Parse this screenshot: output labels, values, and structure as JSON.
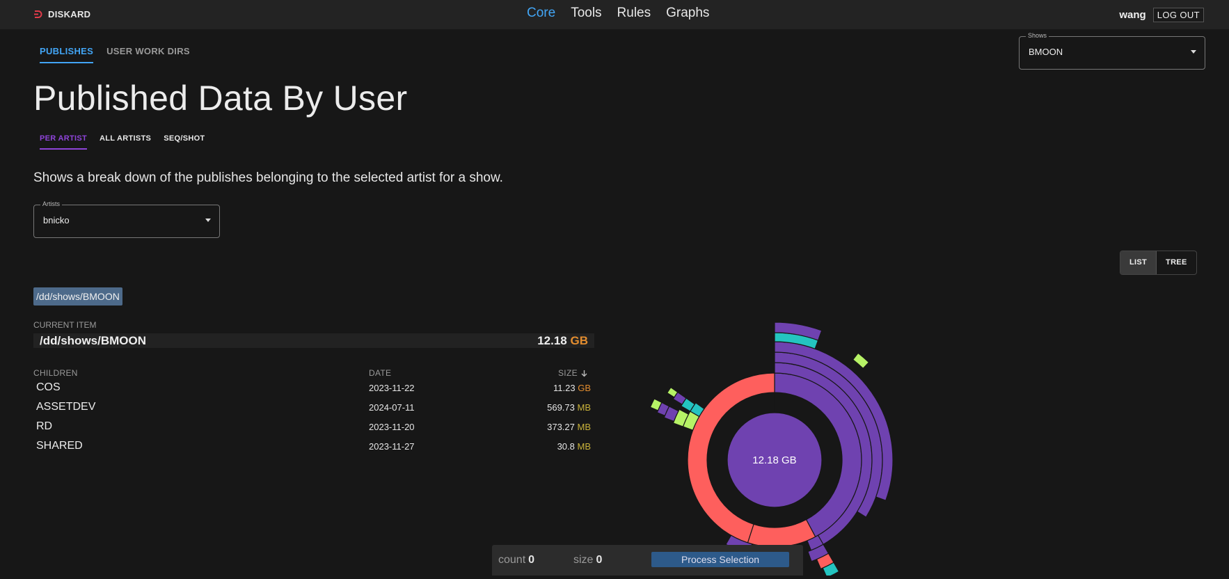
{
  "app": {
    "brand": "DISKARD"
  },
  "nav": {
    "items": [
      "Core",
      "Tools",
      "Rules",
      "Graphs"
    ],
    "active": "Core"
  },
  "user": {
    "name": "wang",
    "logout_label": "LOG OUT"
  },
  "section_tabs": {
    "publishes": "PUBLISHES",
    "user_work_dirs": "USER WORK DIRS"
  },
  "shows": {
    "label": "Shows",
    "value": "BMOON"
  },
  "page": {
    "title": "Published Data By User",
    "description": "Shows a break down of the publishes belonging to the selected artist for a show."
  },
  "view_tabs": {
    "per_artist": "PER ARTIST",
    "all_artists": "ALL ARTISTS",
    "seq_shot": "SEQ/SHOT"
  },
  "artists": {
    "label": "Artists",
    "value": "bnicko"
  },
  "view_toggle": {
    "list": "LIST",
    "tree": "TREE",
    "selected": "LIST"
  },
  "breadcrumb": "/dd/shows/BMOON",
  "current": {
    "label": "CURRENT ITEM",
    "path": "/dd/shows/BMOON",
    "size": "12.18",
    "unit": "GB"
  },
  "table": {
    "headers": {
      "children": "CHILDREN",
      "date": "DATE",
      "size": "SIZE",
      "sort_icon": "arrow-down-icon"
    },
    "rows": [
      {
        "name": "COS",
        "date": "2023-11-22",
        "size": "11.23",
        "unit": "GB"
      },
      {
        "name": "ASSETDEV",
        "date": "2024-07-11",
        "size": "569.73",
        "unit": "MB"
      },
      {
        "name": "RD",
        "date": "2023-11-20",
        "size": "373.27",
        "unit": "MB"
      },
      {
        "name": "SHARED",
        "date": "2023-11-27",
        "size": "30.8",
        "unit": "MB"
      }
    ]
  },
  "sunburst": {
    "center_label": "12.18 GB"
  },
  "selection": {
    "count_label": "count",
    "count": "0",
    "size_label": "size",
    "size": "0",
    "process_label": "Process Selection"
  },
  "colors": {
    "accent": "#42a5f5",
    "purple_tab": "#8e44d9",
    "sun_purple": "#6f42b0",
    "sun_red": "#fe5f5d",
    "sun_teal": "#24c4c0",
    "sun_green": "#b6f266",
    "gb": "#e38d2f",
    "mb": "#c9b23a"
  }
}
